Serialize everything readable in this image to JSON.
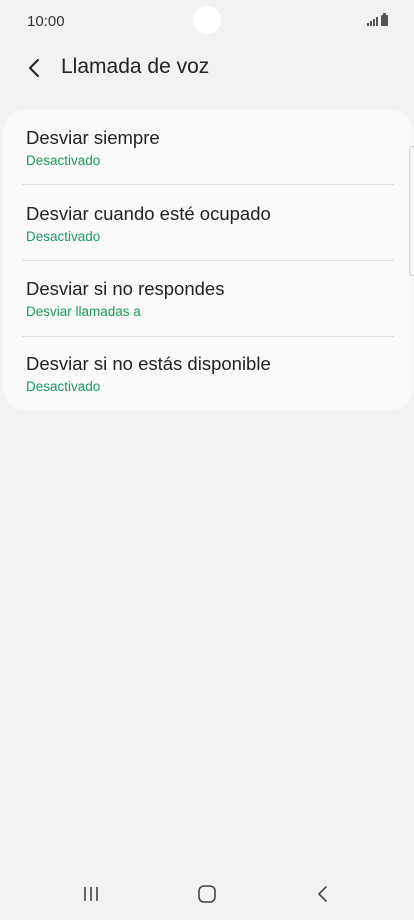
{
  "status_bar": {
    "time": "10:00"
  },
  "header": {
    "title": "Llamada de voz"
  },
  "settings": {
    "items": [
      {
        "title": "Desviar siempre",
        "status": "Desactivado"
      },
      {
        "title": "Desviar cuando esté ocupado",
        "status": "Desactivado"
      },
      {
        "title": "Desviar si no respondes",
        "status": "Desviar llamadas a"
      },
      {
        "title": "Desviar si no estás disponible",
        "status": "Desactivado"
      }
    ]
  },
  "colors": {
    "background": "#f2f2f2",
    "card": "#fafafa",
    "status_text": "#1a9a5c",
    "primary_text": "#222222"
  },
  "icons": {
    "back": "chevron-left-icon",
    "signal": "signal-icon",
    "battery": "battery-icon",
    "nav_recents": "recents-icon",
    "nav_home": "home-icon",
    "nav_back": "back-icon"
  }
}
